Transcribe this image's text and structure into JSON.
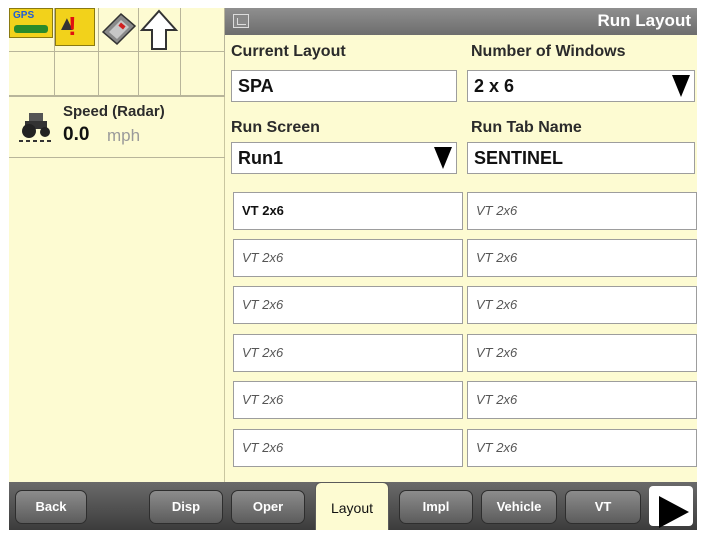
{
  "status_icons": {
    "gps_label": "GPS",
    "items": [
      "gps-icon",
      "warning-icon",
      "implement-icon",
      "up-arrow-icon"
    ]
  },
  "speed": {
    "label": "Speed (Radar)",
    "value": "0.0",
    "unit": "mph"
  },
  "panel": {
    "title": "Run Layout",
    "current_layout_label": "Current Layout",
    "current_layout_value": "SPA",
    "num_windows_label": "Number of Windows",
    "num_windows_value": "2 x 6",
    "run_screen_label": "Run Screen",
    "run_screen_value": "Run1",
    "run_tab_name_label": "Run Tab Name",
    "run_tab_name_value": "SENTINEL"
  },
  "windows": [
    [
      "VT 2x6",
      "VT 2x6"
    ],
    [
      "VT 2x6",
      "VT 2x6"
    ],
    [
      "VT 2x6",
      "VT 2x6"
    ],
    [
      "VT 2x6",
      "VT 2x6"
    ],
    [
      "VT 2x6",
      "VT 2x6"
    ],
    [
      "VT 2x6",
      "VT 2x6"
    ]
  ],
  "tabs": {
    "back": "Back",
    "disp": "Disp",
    "oper": "Oper",
    "layout": "Layout",
    "impl": "Impl",
    "vehicle": "Vehicle",
    "vt": "VT"
  },
  "colors": {
    "background": "#fdfbd2",
    "titlebar": "#7c7c7c",
    "tabbar": "#4a4a4a"
  }
}
